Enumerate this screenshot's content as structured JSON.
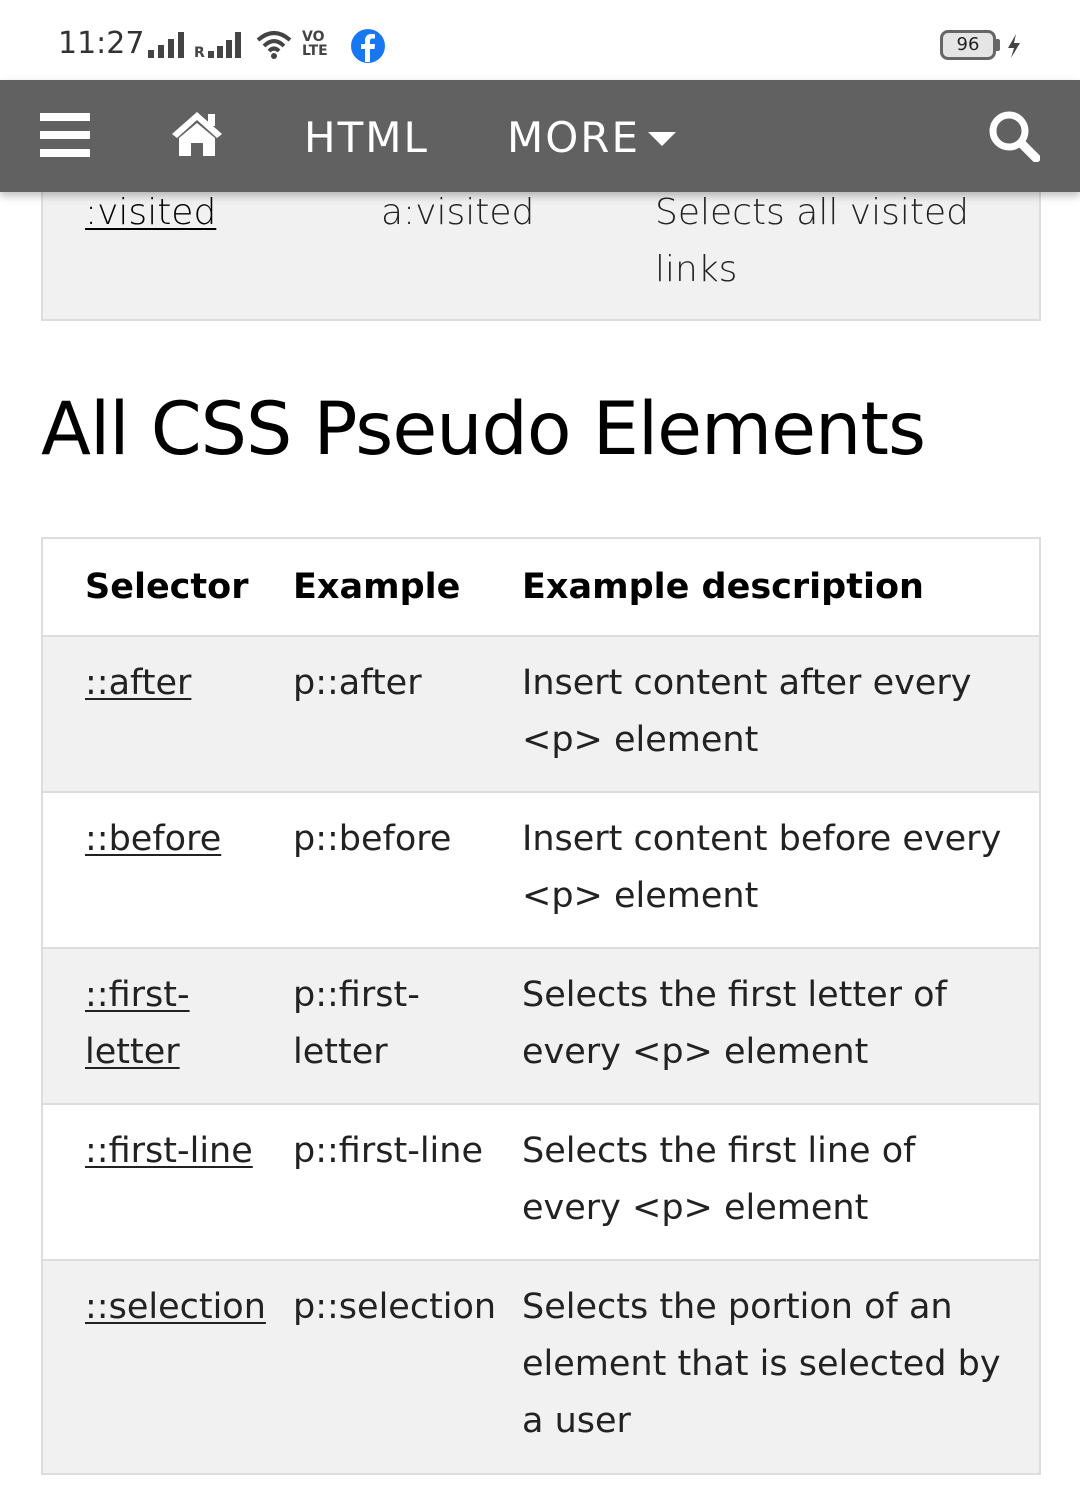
{
  "status_bar": {
    "time": "11:27",
    "volte": "VO LTE",
    "battery": "96"
  },
  "navbar": {
    "html_label": "HTML",
    "more_label": "MORE"
  },
  "prev_table_row": {
    "selector": ":visited",
    "example": "a:visited",
    "description": "Selects all visited links"
  },
  "section": {
    "title": "All CSS Pseudo Elements"
  },
  "table": {
    "headers": [
      "Selector",
      "Example",
      "Example description"
    ],
    "rows": [
      {
        "selector": "::after",
        "example": "p::after",
        "description": "Insert content after every <p> element"
      },
      {
        "selector": "::before",
        "example": "p::before",
        "description": "Insert content before every <p> element"
      },
      {
        "selector": "::first-letter",
        "example": "p::first-letter",
        "description": "Selects the first letter of every <p> element"
      },
      {
        "selector": "::first-line",
        "example": "p::first-line",
        "description": "Selects the first line of every <p> element"
      },
      {
        "selector": "::selection",
        "example": "p::selection",
        "description": "Selects the portion of an element that is selected by a user"
      }
    ]
  },
  "colors": {
    "navbar_bg": "#616161",
    "row_alt_bg": "#f1f1f1",
    "border": "#dddddd",
    "facebook_blue": "#1877f2"
  },
  "icons": [
    "menu-icon",
    "home-icon",
    "caret-down-icon",
    "search-icon",
    "facebook-icon",
    "charging-icon"
  ]
}
